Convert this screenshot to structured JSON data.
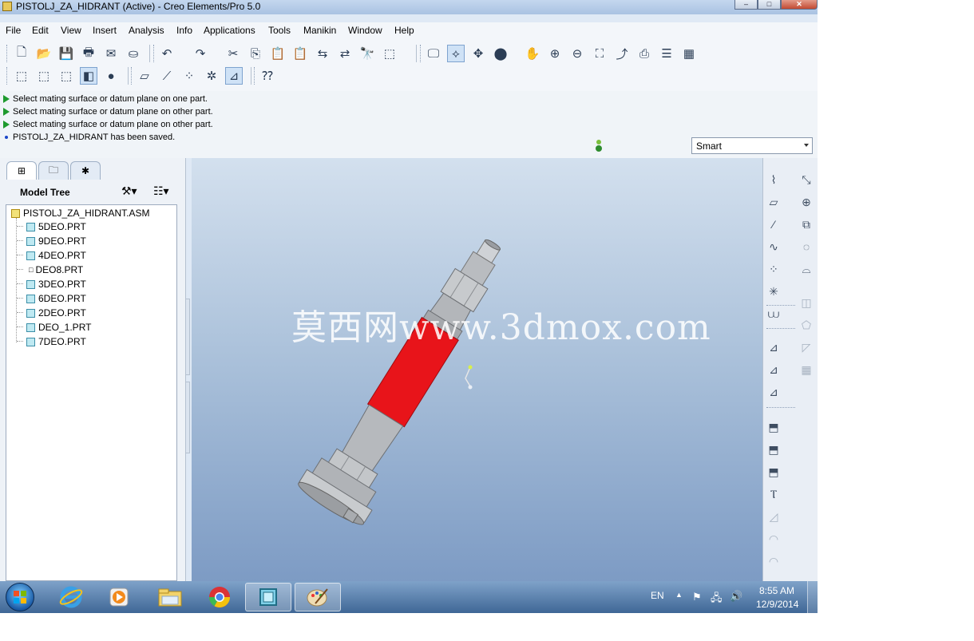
{
  "window": {
    "title": "PISTOLJ_ZA_HIDRANT (Active) - Creo Elements/Pro 5.0",
    "min_label": "–",
    "max_label": "□",
    "close_label": "✕"
  },
  "menubar": {
    "items": [
      "File",
      "Edit",
      "View",
      "Insert",
      "Analysis",
      "Info",
      "Applications",
      "Tools",
      "Manikin",
      "Window",
      "Help"
    ]
  },
  "messages": [
    {
      "type": "prompt",
      "text": "Select mating surface or datum plane on one part."
    },
    {
      "type": "prompt",
      "text": "Select mating surface or datum plane on other part."
    },
    {
      "type": "prompt",
      "text": "Select mating surface or datum plane on other part."
    },
    {
      "type": "info",
      "text": "PISTOLJ_ZA_HIDRANT has been saved."
    }
  ],
  "filter": {
    "selected": "Smart"
  },
  "model_tree": {
    "title": "Model Tree",
    "root": "PISTOLJ_ZA_HIDRANT.ASM",
    "items": [
      "5DEO.PRT",
      "9DEO.PRT",
      "4DEO.PRT",
      "DEO8.PRT",
      "3DEO.PRT",
      "6DEO.PRT",
      "2DEO.PRT",
      "DEO_1.PRT",
      "7DEO.PRT"
    ]
  },
  "graphics": {
    "watermark": "莫西网www.3dmox.com",
    "background_top": "#d3e0ee",
    "background_bottom": "#7d9bc4",
    "highlight_color": "#e8141a"
  },
  "taskbar": {
    "language": "EN",
    "time": "8:55 AM",
    "date": "12/9/2014",
    "apps": [
      "internet-explorer-icon",
      "media-player-icon",
      "file-explorer-icon",
      "chrome-icon",
      "creo-icon",
      "paint-icon"
    ]
  }
}
